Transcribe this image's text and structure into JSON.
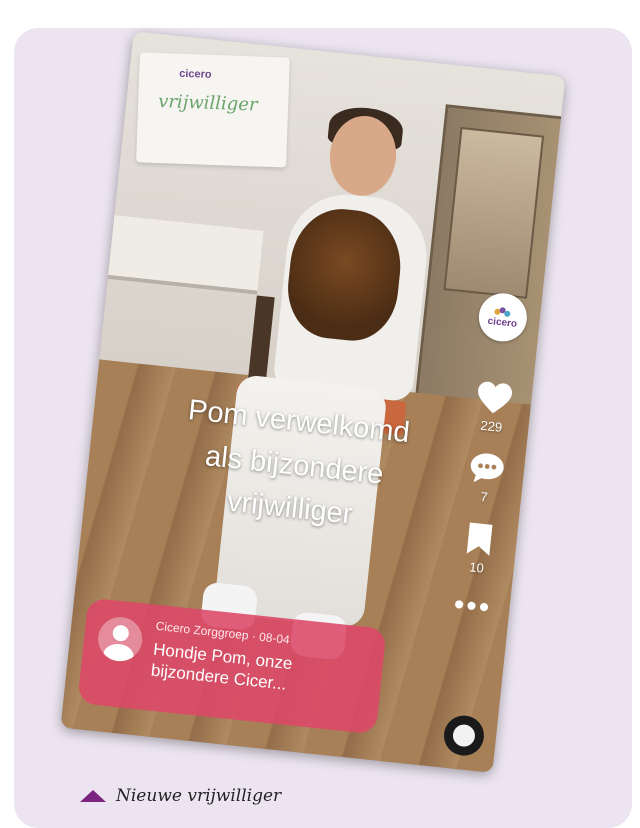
{
  "image_overlay": {
    "title_lines": [
      "Pom verwelkomd",
      "als bijzondere",
      "vrijwilliger"
    ]
  },
  "cloth_print": {
    "brand": "cicero",
    "text": "vrijwilliger"
  },
  "right_rail": {
    "profile_logo_text": "cicero",
    "like_count": "229",
    "comment_count": "7",
    "bookmark_count": "10",
    "more_label": "•••"
  },
  "caption": {
    "author_meta": "Cicero Zorggroep · 08-04",
    "text": "Hondje Pom, onze bijzondere Cicer..."
  },
  "footer": {
    "title": "Nieuwe vrijwilliger"
  },
  "colors": {
    "panel_bg": "#ece5f1",
    "caption_bg": "#dc4868",
    "brand_purple": "#7b2580"
  }
}
